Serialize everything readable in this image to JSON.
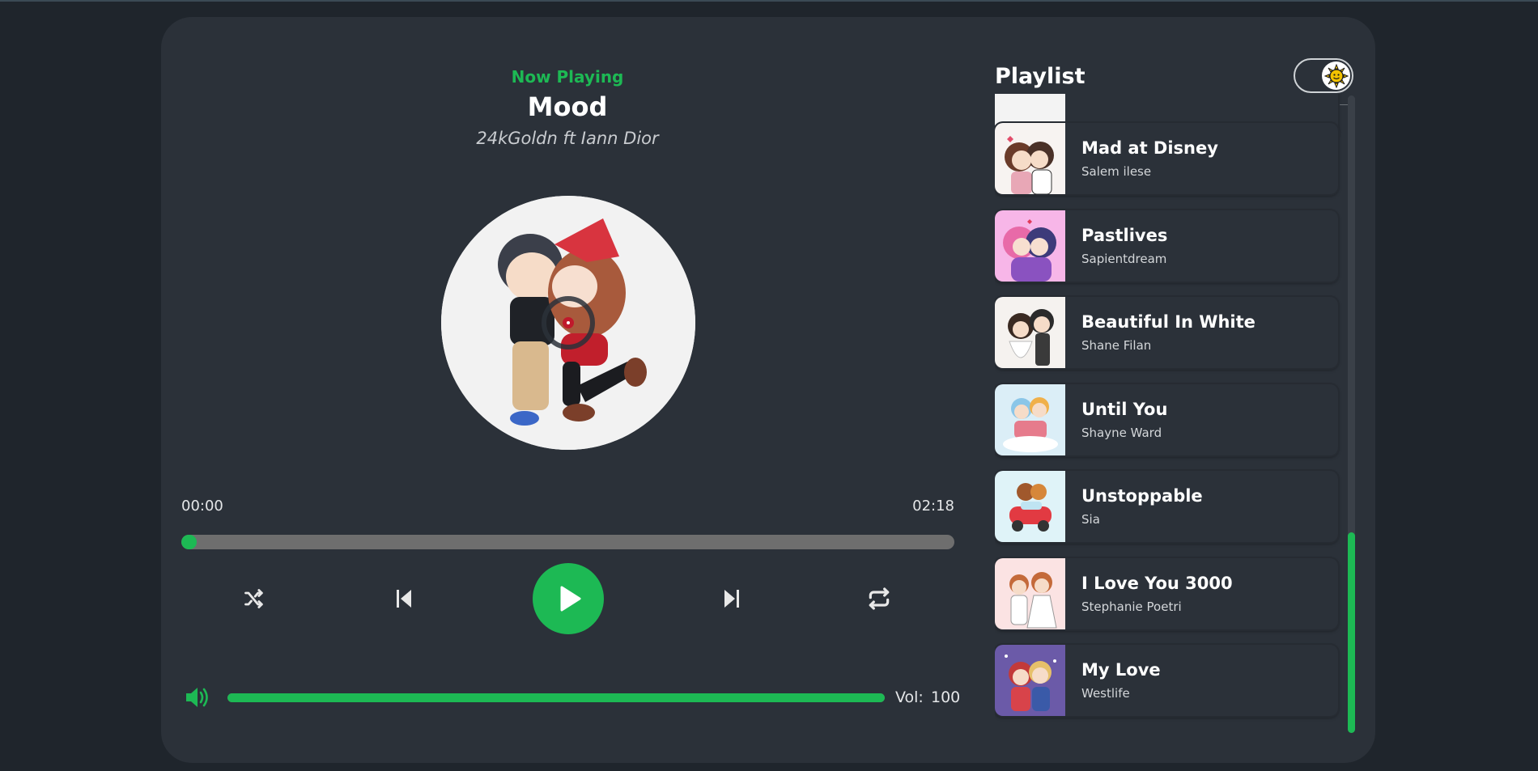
{
  "player": {
    "now_playing_label": "Now Playing",
    "title": "Mood",
    "artist": "24kGoldn ft Iann Dior",
    "cover_icon": "album-cover-art",
    "current_time": "00:00",
    "duration": "02:18",
    "progress_fraction": 0.02,
    "controls": {
      "shuffle_icon": "shuffle-icon",
      "previous_icon": "skip-previous-icon",
      "play_icon": "play-icon",
      "next_icon": "skip-next-icon",
      "repeat_icon": "repeat-icon"
    },
    "volume": {
      "icon": "volume-icon",
      "label": "Vol:",
      "value": "100",
      "level_fraction": 1.0
    }
  },
  "playlist": {
    "title": "Playlist",
    "theme_toggle_icon": "sun-icon",
    "items": [
      {
        "title": "",
        "artist": "",
        "thumb_bg": "#f3f3f3"
      },
      {
        "title": "Mad at Disney",
        "artist": "Salem ilese",
        "thumb_bg": "#f7f3f1"
      },
      {
        "title": "Pastlives",
        "artist": "Sapientdream",
        "thumb_bg": "#f7b6e8"
      },
      {
        "title": "Beautiful In White",
        "artist": "Shane Filan",
        "thumb_bg": "#f5f2ef"
      },
      {
        "title": "Until You",
        "artist": "Shayne Ward",
        "thumb_bg": "#dbeef7"
      },
      {
        "title": "Unstoppable",
        "artist": "Sia",
        "thumb_bg": "#dff3f8"
      },
      {
        "title": "I Love You 3000",
        "artist": "Stephanie Poetri",
        "thumb_bg": "#fbe3e3"
      },
      {
        "title": "My Love",
        "artist": "Westlife",
        "thumb_bg": "#6b5aa8"
      }
    ]
  },
  "colors": {
    "accent": "#1db954",
    "panel": "#2b3139",
    "background": "#1f252c"
  }
}
